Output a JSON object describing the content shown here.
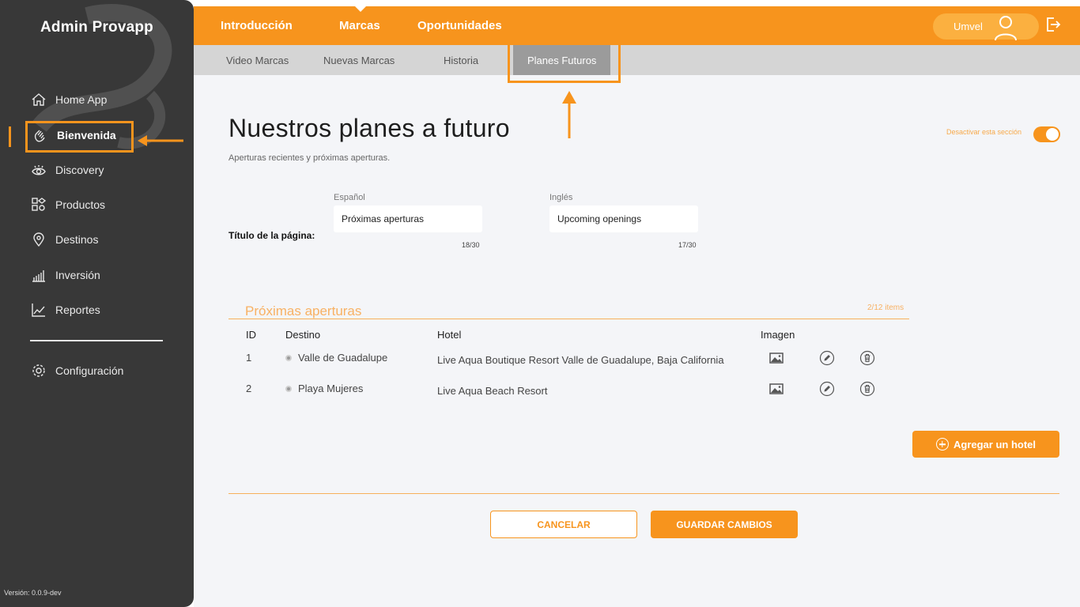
{
  "app": {
    "title": "Admin Provapp",
    "version": "Versión: 0.0.9-dev"
  },
  "sidebar": {
    "items": [
      {
        "label": "Home App",
        "icon": "home-icon"
      },
      {
        "label": "Bienvenida",
        "icon": "waving-hand-icon",
        "active": true
      },
      {
        "label": "Discovery",
        "icon": "eye-icon"
      },
      {
        "label": "Productos",
        "icon": "grid-shapes-icon"
      },
      {
        "label": "Destinos",
        "icon": "location-pin-icon"
      },
      {
        "label": "Inversión",
        "icon": "bar-chart-icon"
      },
      {
        "label": "Reportes",
        "icon": "line-chart-icon"
      }
    ],
    "settings_label": "Configuración"
  },
  "topnav": {
    "tabs": [
      {
        "label": "Introducción"
      },
      {
        "label": "Marcas",
        "active": true
      },
      {
        "label": "Oportunidades"
      }
    ],
    "user_name": "Umvel"
  },
  "subnav": {
    "tabs": [
      {
        "label": "Video Marcas"
      },
      {
        "label": "Nuevas Marcas"
      },
      {
        "label": "Historia"
      },
      {
        "label": "Planes Futuros",
        "active": true
      }
    ]
  },
  "page": {
    "title": "Nuestros planes a futuro",
    "subtitle": "Aperturas recientes y próximas aperturas.",
    "toggle_label": "Desactivar esta sección",
    "toggle_on": true
  },
  "form": {
    "field_title": "Título de la página:",
    "spanish": {
      "label": "Español",
      "value": "Próximas aperturas",
      "counter": "18/30"
    },
    "english": {
      "label": "Inglés",
      "value": "Upcoming openings",
      "counter": "17/30"
    }
  },
  "section": {
    "title": "Próximas aperturas",
    "count": "2/12 items",
    "headers": {
      "id": "ID",
      "destino": "Destino",
      "hotel": "Hotel",
      "imagen": "Imagen"
    },
    "rows": [
      {
        "id": "1",
        "destino": "Valle de Guadalupe",
        "hotel": "Live Aqua Boutique Resort Valle de Guadalupe, Baja California"
      },
      {
        "id": "2",
        "destino": "Playa Mujeres",
        "hotel": "Live Aqua Beach Resort"
      }
    ]
  },
  "actions": {
    "add_hotel": "Agregar un hotel",
    "cancel": "CANCELAR",
    "save": "GUARDAR CAMBIOS"
  },
  "colors": {
    "accent": "#f7941d",
    "sidebar": "#383838",
    "subnav": "#d5d5d5",
    "background": "#f4f5f8"
  }
}
